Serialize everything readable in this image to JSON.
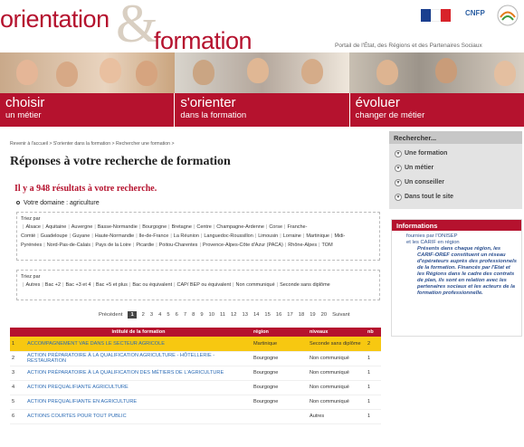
{
  "header": {
    "logo_line1": "orientation",
    "logo_line2": "formation",
    "tagline": "Portail de l'État, des Régions et des Partenaires Sociaux",
    "partner_logo": "CNFP"
  },
  "nav": [
    {
      "big": "choisir",
      "small": "un métier"
    },
    {
      "big": "s'orienter",
      "small": "dans la formation"
    },
    {
      "big": "évoluer",
      "small": "changer de métier"
    }
  ],
  "breadcrumb": "Revenir à l'accueil  >  S'orienter dans la formation  >  Rechercher une formation  >",
  "page_title": "Réponses à votre recherche de formation",
  "result_count": "Il y a 948 résultats à votre recherche.",
  "domain": "Votre domaine : agriculture",
  "filters": {
    "regions_label": "Triez par",
    "regions": [
      "Alsace",
      "Aquitaine",
      "Auvergne",
      "Basse-Normandie",
      "Bourgogne",
      "Bretagne",
      "Centre",
      "Champagne-Ardenne",
      "Corse",
      "Franche-Comté",
      "Guadeloupe",
      "Guyane",
      "Haute-Normandie",
      "Ile-de-France",
      "La Réunion",
      "Languedoc-Roussillon",
      "Limousin",
      "Lorraine",
      "Martinique",
      "Midi-Pyrénées",
      "Nord-Pas-de-Calais",
      "Pays de la Loire",
      "Picardie",
      "Poitou-Charentes",
      "Provence-Alpes-Côte d'Azur (PACA)",
      "Rhône-Alpes",
      "TOM"
    ],
    "levels_label": "Triez par",
    "levels": [
      "Autres",
      "Bac +2",
      "Bac +3 et 4",
      "Bac +5 et plus",
      "Bac ou équivalent",
      "CAP/ BEP ou équivalent",
      "Non communiqué",
      "Seconde sans diplôme"
    ]
  },
  "pager": {
    "prev": "Précédent",
    "current": "1",
    "pages": [
      "2",
      "3",
      "4",
      "5",
      "6",
      "7",
      "8",
      "9",
      "10",
      "11",
      "12",
      "13",
      "14",
      "15",
      "16",
      "17",
      "18",
      "19",
      "20"
    ],
    "next": "Suivant"
  },
  "table": {
    "headers": [
      "",
      "intitulé de la formation",
      "région",
      "niveaux",
      "nb"
    ],
    "rows": [
      {
        "n": "1",
        "title": "ACCOMPAGNEMENT VAE DANS LE SECTEUR AGRICOLE",
        "region": "Martinique",
        "level": "Seconde sans diplôme",
        "nb": "2"
      },
      {
        "n": "2",
        "title": "ACTION PRÉPARATOIRE À LA QUALIFICATION AGRICULTURE - HÔTELLERIE - RESTAURATION",
        "region": "Bourgogne",
        "level": "Non communiqué",
        "nb": "1"
      },
      {
        "n": "3",
        "title": "ACTION PRÉPARATOIRE À LA QUALIFICATION DES MÉTIERS DE L'AGRICULTURE",
        "region": "Bourgogne",
        "level": "Non communiqué",
        "nb": "1"
      },
      {
        "n": "4",
        "title": "ACTION PREQUALIFIANTE AGRICULTURE",
        "region": "Bourgogne",
        "level": "Non communiqué",
        "nb": "1"
      },
      {
        "n": "5",
        "title": "ACTION PREQUALIFIANTE EN AGRICULTURE",
        "region": "Bourgogne",
        "level": "Non communiqué",
        "nb": "1"
      },
      {
        "n": "6",
        "title": "ACTIONS COURTES POUR TOUT PUBLIC",
        "region": "",
        "level": "Autres",
        "nb": "1"
      }
    ]
  },
  "sidebar": {
    "search_title": "Rechercher...",
    "search_items": [
      "Une formation",
      "Un métier",
      "Un conseiller",
      "Dans tout le site"
    ],
    "info_title": "Informations",
    "info_line1": "fournies par l'ONISEP",
    "info_line2": "et les CARIF en région",
    "info_body": "Présents dans chaque région, les CARIF-OREF constituent un réseau d'opérateurs auprès des professionnels de la formation. Financés par l'Etat et les Régions dans le cadre des contrats de plan, ils sont en relation avec les partenaires sociaux et les acteurs de la formation professionnelle."
  },
  "colors": {
    "brand": "#b5122e",
    "highlight": "#f7c811",
    "link": "#2b6bb5"
  }
}
